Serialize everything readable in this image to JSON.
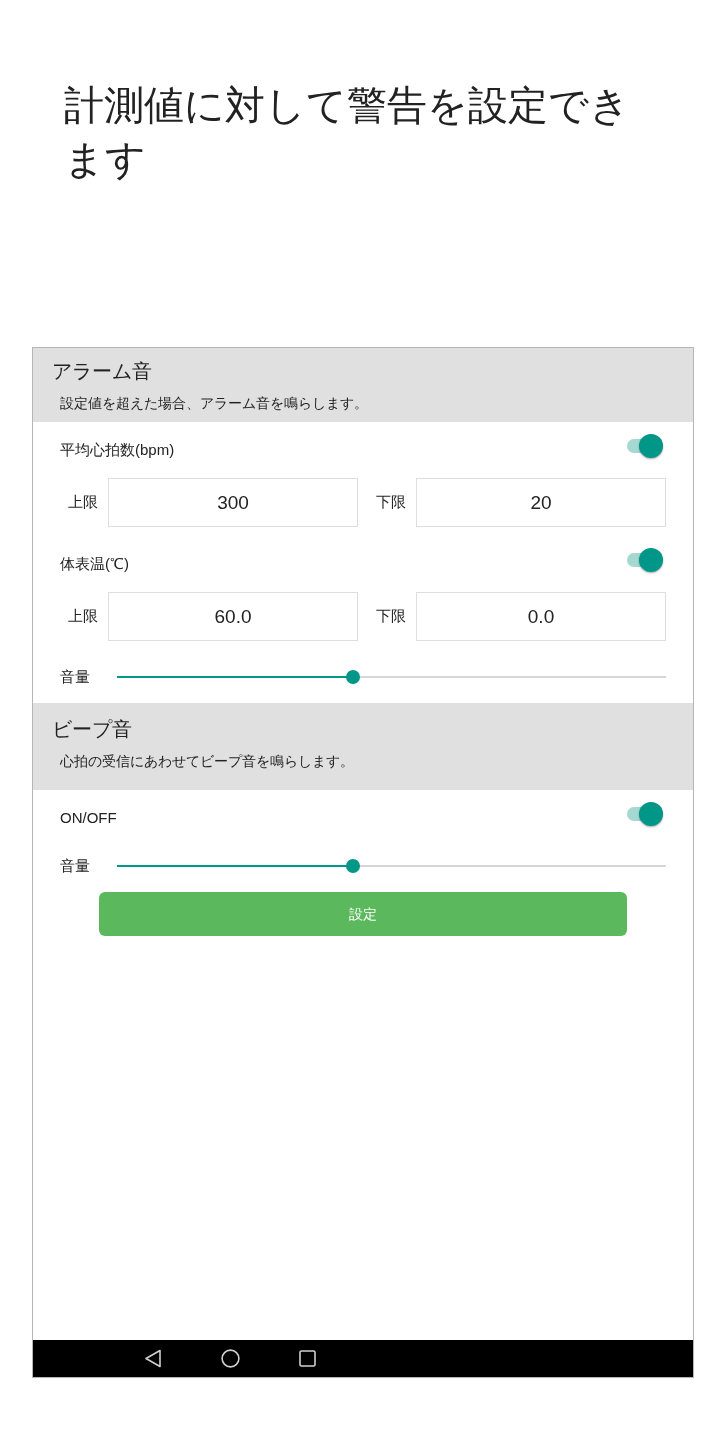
{
  "headline": "計測値に対して警告を設定できます",
  "sections": [
    {
      "title": "アラーム音",
      "description": "設定値を超えた場合、アラーム音を鳴らします。",
      "items": [
        {
          "kind": "toggle",
          "label": "平均心拍数(bpm)",
          "on": true
        },
        {
          "kind": "limits",
          "fields": [
            {
              "label": "上限",
              "value": "300"
            },
            {
              "label": "下限",
              "value": "20"
            }
          ]
        },
        {
          "kind": "toggle",
          "label": "体表温(℃)",
          "on": true
        },
        {
          "kind": "limits",
          "fields": [
            {
              "label": "上限",
              "value": "60.0"
            },
            {
              "label": "下限",
              "value": "0.0"
            }
          ]
        },
        {
          "kind": "slider",
          "label": "音量",
          "level": 0.43
        }
      ]
    },
    {
      "title": "ビープ音",
      "description": "心拍の受信にあわせてビープ音を鳴らします。",
      "items": [
        {
          "kind": "toggle",
          "label": "ON/OFF",
          "on": true
        },
        {
          "kind": "slider",
          "label": "音量",
          "level": 0.43
        }
      ]
    }
  ],
  "button": {
    "label": "設定"
  }
}
